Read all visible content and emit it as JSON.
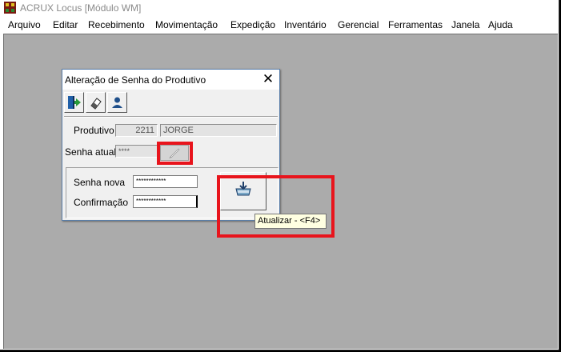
{
  "app": {
    "title": "ACRUX Locus [Módulo WM]",
    "icon": "app-logo-icon"
  },
  "menu": [
    {
      "label": "Arquivo"
    },
    {
      "label": "Editar"
    },
    {
      "label": "Recebimento"
    },
    {
      "label": "Movimentação"
    },
    {
      "label": "Expedição"
    },
    {
      "label": "Inventário"
    },
    {
      "label": "Gerencial"
    },
    {
      "label": "Ferramentas"
    },
    {
      "label": "Janela"
    },
    {
      "label": "Ajuda"
    }
  ],
  "dialog": {
    "title": "Alteração de Senha do Produtivo",
    "close_glyph": "✕",
    "toolbar": [
      {
        "icon": "exit-door-icon"
      },
      {
        "icon": "eraser-icon"
      },
      {
        "icon": "user-icon"
      }
    ],
    "produtivo": {
      "label": "Produtivo",
      "code": "2211",
      "name": "JORGE"
    },
    "senha_atual": {
      "label": "Senha atual",
      "value": "****"
    },
    "senha_nova": {
      "label": "Senha nova",
      "value": "************"
    },
    "confirmacao": {
      "label": "Confirmação",
      "value": "************"
    },
    "update_button": {
      "icon": "update-save-icon",
      "tooltip": "Atualizar - <F4>"
    }
  },
  "colors": {
    "mdi_background": "#ababab",
    "highlight": "#e8141c",
    "tooltip_background": "#ffffe1"
  }
}
